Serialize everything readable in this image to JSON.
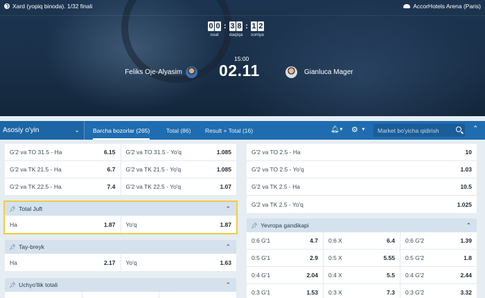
{
  "header": {
    "tournament": "Xard (yopiq binoda). 1/32 finali",
    "venue": "AccorHotels Arena (Paris)",
    "timer": {
      "hours": [
        "0",
        "0"
      ],
      "minutes": [
        "3",
        "8"
      ],
      "seconds": [
        "1",
        "2"
      ],
      "hours_label": "soat",
      "minutes_label": "daqiqa",
      "seconds_label": "soniya"
    },
    "start_time": "15:00",
    "date": "02.11",
    "player1": "Feliks Oje-Alyasim",
    "player2": "Gianluca Mager"
  },
  "tabbar": {
    "main_select": "Asosiy o'yin",
    "tabs": [
      {
        "label": "Barcha bozorlar",
        "count": "(265)"
      },
      {
        "label": "Total",
        "count": "(86)"
      },
      {
        "label": "Result + Total",
        "count": "(16)"
      }
    ],
    "search_placeholder": "Market bo'yicha qidirish"
  },
  "left": {
    "top_rows": [
      [
        {
          "label": "G'2 va TO 31.5 - Ha",
          "odd": "6.15"
        },
        {
          "label": "G'2 va TO 31.5 - Yo'q",
          "odd": "1.085"
        }
      ],
      [
        {
          "label": "G'2 va TK 21.5 - Ha",
          "odd": "6.7"
        },
        {
          "label": "G'2 va TK 21.5 - Yo'q",
          "odd": "1.085"
        }
      ],
      [
        {
          "label": "G'2 va TK 22.5 - Ha",
          "odd": "7.4"
        },
        {
          "label": "G'2 va TK 22.5 - Yo'q",
          "odd": "1.07"
        }
      ]
    ],
    "total_juft": {
      "title": "Total Juft",
      "rows": [
        [
          {
            "label": "Ha",
            "odd": "1.87"
          },
          {
            "label": "Yo'q",
            "odd": "1.87"
          }
        ]
      ]
    },
    "tay_breyk": {
      "title": "Tay-breyk",
      "rows": [
        [
          {
            "label": "Ha",
            "odd": "2.17"
          },
          {
            "label": "Yo'q",
            "odd": "1.63"
          }
        ]
      ]
    },
    "uchyollik": {
      "title": "Uchyo'llik totali"
    }
  },
  "right": {
    "top_rows": [
      [
        {
          "label": "G'2 va TO 2.5 - Ha",
          "odd": "10"
        }
      ],
      [
        {
          "label": "G'2 va TO 2.5 - Yo'q",
          "odd": "1.03"
        }
      ],
      [
        {
          "label": "G'2 va TK 2.5 - Ha",
          "odd": "10.5"
        }
      ],
      [
        {
          "label": "G'2 va TK 2.5 - Yo'q",
          "odd": "1.025"
        }
      ]
    ],
    "yevropa": {
      "title": "Yevropa gandikapi",
      "rows": [
        [
          {
            "label": "0:6 G'1",
            "odd": "4.7"
          },
          {
            "label": "0:6 X",
            "odd": "6.4"
          },
          {
            "label": "0:6 G'2",
            "odd": "1.39"
          }
        ],
        [
          {
            "label": "0:5 G'1",
            "odd": "2.9"
          },
          {
            "label": "0:5 X",
            "odd": "5.55"
          },
          {
            "label": "0:5 G'2",
            "odd": "1.8"
          }
        ],
        [
          {
            "label": "0:4 G'1",
            "odd": "2.04"
          },
          {
            "label": "0:4 X",
            "odd": "5.5"
          },
          {
            "label": "0:4 G'2",
            "odd": "2.44"
          }
        ],
        [
          {
            "label": "0:3 G'1",
            "odd": "1.53"
          },
          {
            "label": "0:3 X",
            "odd": "7.3"
          },
          {
            "label": "0:3 G'2",
            "odd": "3.32"
          }
        ]
      ]
    }
  },
  "colors": {
    "accent": "#1f6db0",
    "highlight": "#f0cc45",
    "header_bg": "#1a3049"
  }
}
